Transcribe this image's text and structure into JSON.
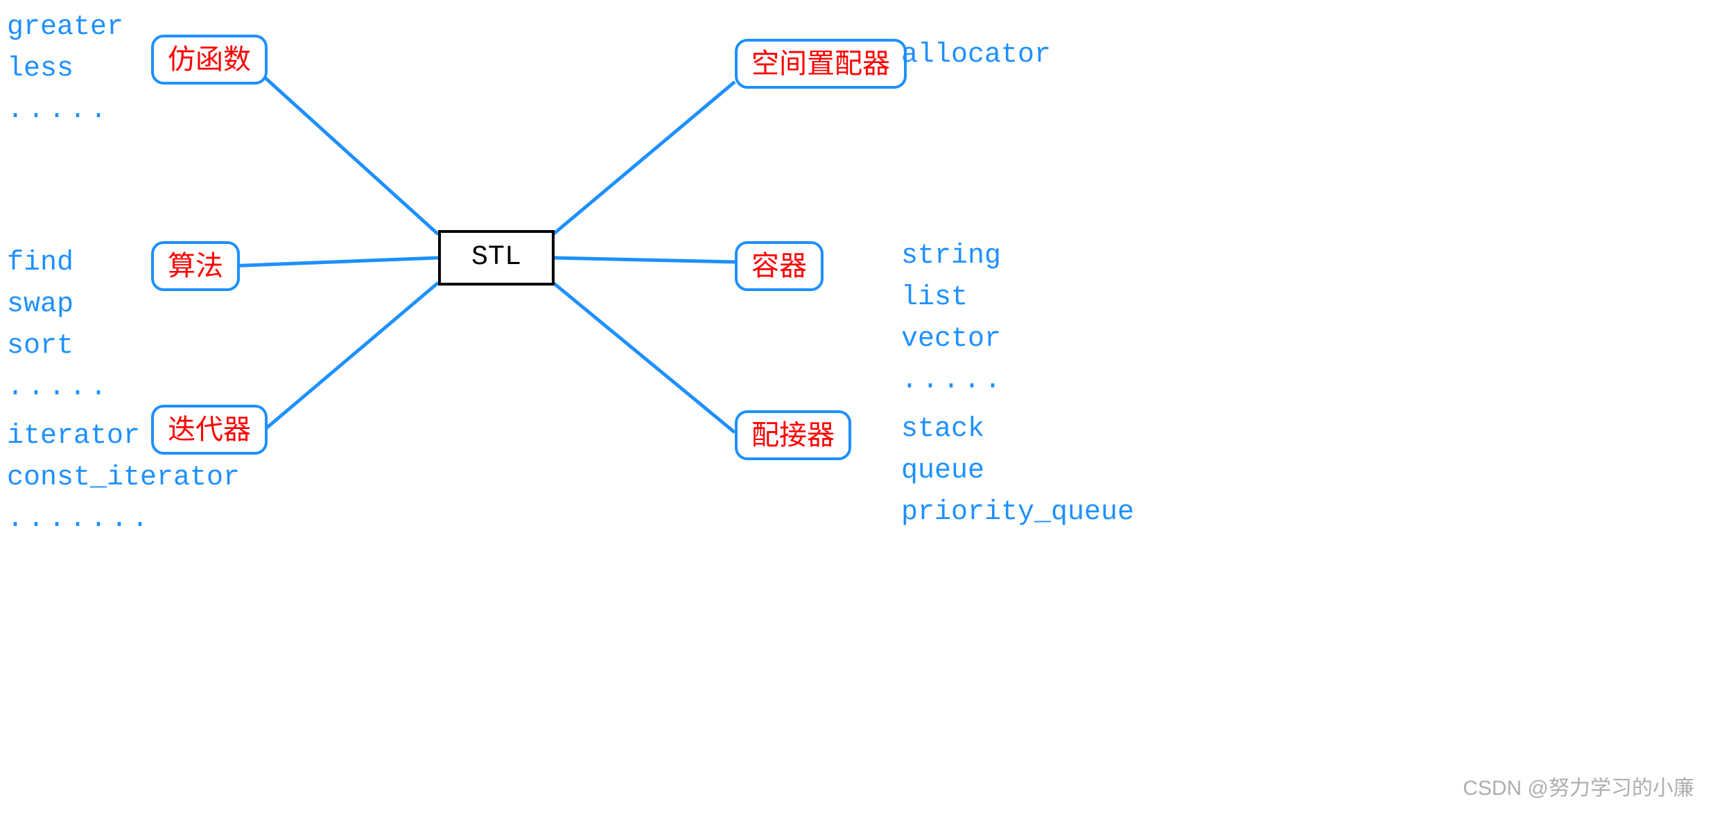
{
  "center": {
    "label": "STL"
  },
  "nodes": {
    "functor": {
      "label": "仿函数"
    },
    "algorithm": {
      "label": "算法"
    },
    "iterator": {
      "label": "迭代器"
    },
    "allocator": {
      "label": "空间置配器"
    },
    "container": {
      "label": "容器"
    },
    "adapter": {
      "label": "配接器"
    }
  },
  "sidetext": {
    "functor_examples": "greater\nless\n.....",
    "algorithm_examples": "find\nswap\nsort\n.....",
    "iterator_examples": "iterator\nconst_iterator\n.......",
    "allocator_examples": "allocator",
    "container_examples": "string\nlist\nvector\n.....",
    "adapter_examples": "stack\nqueue\npriority_queue"
  },
  "watermark": "CSDN @努力学习的小廉"
}
